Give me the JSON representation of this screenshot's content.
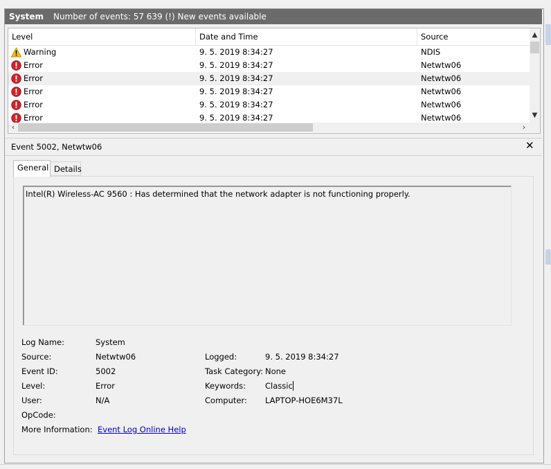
{
  "log_header": {
    "log_name": "System",
    "event_count_text": "Number of events: 57 639 (!) New events available"
  },
  "events_table": {
    "columns": [
      "Level",
      "Date and Time",
      "Source"
    ],
    "rows": [
      {
        "level": "Warning",
        "icon": "warning-icon",
        "datetime": "9. 5. 2019 8:34:27",
        "source": "NDIS"
      },
      {
        "level": "Error",
        "icon": "error-icon",
        "datetime": "9. 5. 2019 8:34:27",
        "source": "Netwtw06"
      },
      {
        "level": "Error",
        "icon": "error-icon",
        "datetime": "9. 5. 2019 8:34:27",
        "source": "Netwtw06",
        "selected": true
      },
      {
        "level": "Error",
        "icon": "error-icon",
        "datetime": "9. 5. 2019 8:34:27",
        "source": "Netwtw06"
      },
      {
        "level": "Error",
        "icon": "error-icon",
        "datetime": "9. 5. 2019 8:34:27",
        "source": "Netwtw06"
      },
      {
        "level": "Error",
        "icon": "error-icon",
        "datetime": "9. 5. 2019 8:34:27",
        "source": "Netwtw06"
      }
    ]
  },
  "event_detail": {
    "title": "Event 5002, Netwtw06",
    "close_glyph": "✕",
    "tabs": [
      "General",
      "Details"
    ],
    "active_tab": "General",
    "description": "Intel(R) Wireless-AC 9560 : Has determined that the network adapter is not functioning properly.",
    "properties": {
      "log_name_label": "Log Name:",
      "log_name_value": "System",
      "source_label": "Source:",
      "source_value": "Netwtw06",
      "event_id_label": "Event ID:",
      "event_id_value": "5002",
      "level_label": "Level:",
      "level_value": "Error",
      "user_label": "User:",
      "user_value": "N/A",
      "opcode_label": "OpCode:",
      "more_info_label": "More Information:",
      "more_info_link": "Event Log Online Help",
      "logged_label": "Logged:",
      "logged_value": "9. 5. 2019 8:34:27",
      "task_category_label": "Task Category:",
      "task_category_value": "None",
      "keywords_label": "Keywords:",
      "keywords_value": "Classic",
      "computer_label": "Computer:",
      "computer_value": "LAPTOP-HOE6M37L"
    }
  },
  "colors": {
    "titlebar_bg": "#6b6b6b",
    "error_red": "#d2222a",
    "warning_yellow": "#f5c400",
    "link_blue": "#0000cc"
  }
}
